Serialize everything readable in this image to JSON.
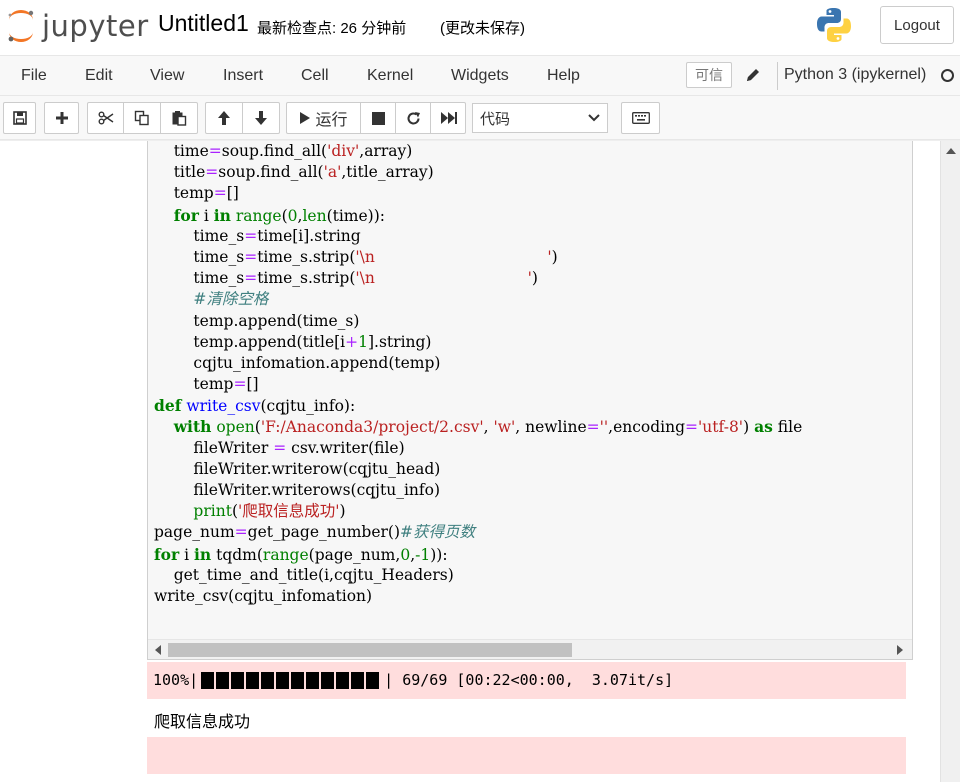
{
  "header": {
    "logo_text": "jupyter",
    "notebook_name": "Untitled1",
    "checkpoint": "最新检查点: 26 分钟前",
    "autosave_status": "(更改未保存)",
    "logout_label": "Logout"
  },
  "menubar": {
    "items": [
      "File",
      "Edit",
      "View",
      "Insert",
      "Cell",
      "Kernel",
      "Widgets",
      "Help"
    ],
    "trusted_label": "可信",
    "kernel_name": "Python 3 (ipykernel)"
  },
  "toolbar": {
    "run_label": "运行",
    "cell_type_selected": "代码"
  },
  "code_lines": [
    [
      {
        "t": "    time",
        "c": ""
      },
      {
        "t": "=",
        "c": "op"
      },
      {
        "t": "soup.find_all(",
        "c": ""
      },
      {
        "t": "'div'",
        "c": "str"
      },
      {
        "t": ",array)",
        "c": ""
      }
    ],
    [
      {
        "t": "    title",
        "c": ""
      },
      {
        "t": "=",
        "c": "op"
      },
      {
        "t": "soup.find_all(",
        "c": ""
      },
      {
        "t": "'a'",
        "c": "str"
      },
      {
        "t": ",title_array)",
        "c": ""
      }
    ],
    [
      {
        "t": "    temp",
        "c": ""
      },
      {
        "t": "=",
        "c": "op"
      },
      {
        "t": "[]",
        "c": ""
      }
    ],
    [
      {
        "t": "    ",
        "c": ""
      },
      {
        "t": "for",
        "c": "kw"
      },
      {
        "t": " i ",
        "c": ""
      },
      {
        "t": "in",
        "c": "kw"
      },
      {
        "t": " ",
        "c": ""
      },
      {
        "t": "range",
        "c": "bi"
      },
      {
        "t": "(",
        "c": ""
      },
      {
        "t": "0",
        "c": "num"
      },
      {
        "t": ",",
        "c": ""
      },
      {
        "t": "len",
        "c": "bi"
      },
      {
        "t": "(time)):",
        "c": ""
      }
    ],
    [
      {
        "t": "        time_s",
        "c": ""
      },
      {
        "t": "=",
        "c": "op"
      },
      {
        "t": "time[i].string",
        "c": ""
      }
    ],
    [
      {
        "t": "        time_s",
        "c": ""
      },
      {
        "t": "=",
        "c": "op"
      },
      {
        "t": "time_s.strip(",
        "c": ""
      },
      {
        "t": "'\\n                                   '",
        "c": "str"
      },
      {
        "t": ")",
        "c": ""
      }
    ],
    [
      {
        "t": "        time_s",
        "c": ""
      },
      {
        "t": "=",
        "c": "op"
      },
      {
        "t": "time_s.strip(",
        "c": ""
      },
      {
        "t": "'\\n                               '",
        "c": "str"
      },
      {
        "t": ")",
        "c": ""
      }
    ],
    [
      {
        "t": "        ",
        "c": ""
      },
      {
        "t": "#清除空格",
        "c": "cm"
      }
    ],
    [
      {
        "t": "        temp.append(time_s)",
        "c": ""
      }
    ],
    [
      {
        "t": "        temp.append(title[i",
        "c": ""
      },
      {
        "t": "+",
        "c": "op"
      },
      {
        "t": "1",
        "c": "num"
      },
      {
        "t": "].string)",
        "c": ""
      }
    ],
    [
      {
        "t": "        cqjtu_infomation.append(temp)",
        "c": ""
      }
    ],
    [
      {
        "t": "        temp",
        "c": ""
      },
      {
        "t": "=",
        "c": "op"
      },
      {
        "t": "[]",
        "c": ""
      }
    ],
    [
      {
        "t": "def",
        "c": "kw"
      },
      {
        "t": " ",
        "c": ""
      },
      {
        "t": "write_csv",
        "c": "fn"
      },
      {
        "t": "(cqjtu_info):",
        "c": ""
      }
    ],
    [
      {
        "t": "    ",
        "c": ""
      },
      {
        "t": "with",
        "c": "kw"
      },
      {
        "t": " ",
        "c": ""
      },
      {
        "t": "open",
        "c": "bi"
      },
      {
        "t": "(",
        "c": ""
      },
      {
        "t": "'F:/Anaconda3/project/2.csv'",
        "c": "str"
      },
      {
        "t": ", ",
        "c": ""
      },
      {
        "t": "'w'",
        "c": "str"
      },
      {
        "t": ", newline",
        "c": ""
      },
      {
        "t": "=",
        "c": "op"
      },
      {
        "t": "''",
        "c": "str"
      },
      {
        "t": ",encoding",
        "c": ""
      },
      {
        "t": "=",
        "c": "op"
      },
      {
        "t": "'utf-8'",
        "c": "str"
      },
      {
        "t": ") ",
        "c": ""
      },
      {
        "t": "as",
        "c": "kw"
      },
      {
        "t": " file",
        "c": ""
      }
    ],
    [
      {
        "t": "        fileWriter ",
        "c": ""
      },
      {
        "t": "=",
        "c": "op"
      },
      {
        "t": " csv.writer(file)",
        "c": ""
      }
    ],
    [
      {
        "t": "        fileWriter.writerow(cqjtu_head)",
        "c": ""
      }
    ],
    [
      {
        "t": "        fileWriter.writerows(cqjtu_info)",
        "c": ""
      }
    ],
    [
      {
        "t": "        ",
        "c": ""
      },
      {
        "t": "print",
        "c": "bi"
      },
      {
        "t": "(",
        "c": ""
      },
      {
        "t": "'爬取信息成功'",
        "c": "str"
      },
      {
        "t": ")",
        "c": ""
      }
    ],
    [
      {
        "t": "page_num",
        "c": ""
      },
      {
        "t": "=",
        "c": "op"
      },
      {
        "t": "get_page_number()",
        "c": ""
      },
      {
        "t": "#获得页数",
        "c": "cm"
      }
    ],
    [
      {
        "t": "for",
        "c": "kw"
      },
      {
        "t": " i ",
        "c": ""
      },
      {
        "t": "in",
        "c": "kw"
      },
      {
        "t": " tqdm(",
        "c": ""
      },
      {
        "t": "range",
        "c": "bi"
      },
      {
        "t": "(page_num,",
        "c": ""
      },
      {
        "t": "0",
        "c": "num"
      },
      {
        "t": ",",
        "c": ""
      },
      {
        "t": "-1",
        "c": "num"
      },
      {
        "t": ")):",
        "c": ""
      }
    ],
    [
      {
        "t": "    get_time_and_title(i,cqjtu_Headers)",
        "c": ""
      }
    ],
    [
      {
        "t": "write_csv(cqjtu_infomation)",
        "c": ""
      }
    ]
  ],
  "output": {
    "progress_percent_label": "100%",
    "progress_fraction": 1.0,
    "progress_stats": "| 69/69 [00:22<00:00,  3.07it/s]",
    "stdout_text": "爬取信息成功"
  }
}
